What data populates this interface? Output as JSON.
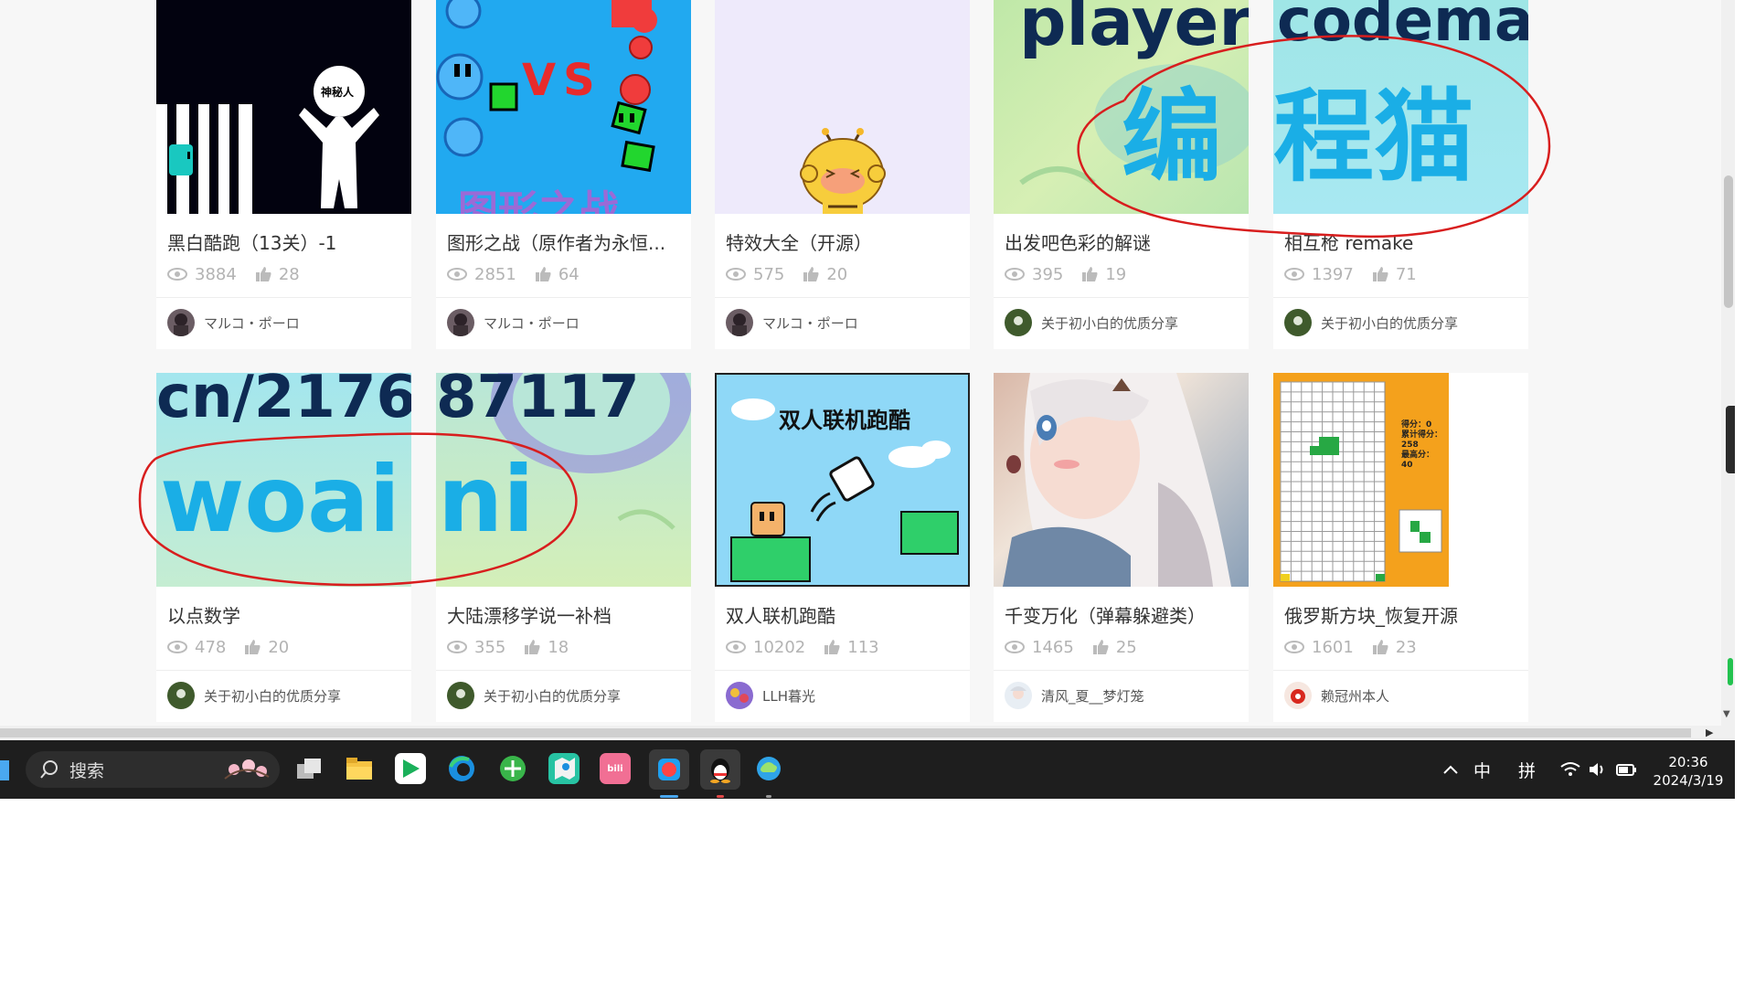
{
  "cards": [
    {
      "title": "黑白酷跑（13关）-1",
      "views": "3884",
      "likes": "28",
      "author": "マルコ・ポーロ"
    },
    {
      "title": "图形之战（原作者为永恒...",
      "views": "2851",
      "likes": "64",
      "author": "マルコ・ポーロ"
    },
    {
      "title": "特效大全（开源）",
      "views": "575",
      "likes": "20",
      "author": "マルコ・ポーロ"
    },
    {
      "title": "出发吧色彩的解谜",
      "views": "395",
      "likes": "19",
      "author": "关于初小白的优质分享"
    },
    {
      "title": "相互枪 remake",
      "views": "1397",
      "likes": "71",
      "author": "关于初小白的优质分享"
    },
    {
      "title": "以点数学",
      "views": "478",
      "likes": "20",
      "author": "关于初小白的优质分享"
    },
    {
      "title": "大陆漂移学说一补档",
      "views": "355",
      "likes": "18",
      "author": "关于初小白的优质分享"
    },
    {
      "title": "双人联机跑酷",
      "views": "10202",
      "likes": "113",
      "author": "LLH暮光"
    },
    {
      "title": "千变万化（弹幕躲避类）",
      "views": "1465",
      "likes": "25",
      "author": "清风_夏__梦灯笼"
    },
    {
      "title": "俄罗斯方块_恢复开源",
      "views": "1601",
      "likes": "23",
      "author": "赖冠州本人"
    }
  ],
  "thumb_text": {
    "mystery_label": "神秘人",
    "vs": "VS",
    "shape_war": "图形之战",
    "player": "player.",
    "codemao": "codemao.",
    "bian": "编",
    "cheng_mao": "程猫",
    "url_a": "cn/2176",
    "url_b": "87117",
    "woai": "woai",
    "ni": "ni",
    "parkour": "双人联机跑酷",
    "tetris_score": "得分：0",
    "tetris_total": "累计得分：",
    "tetris_total_val": "258",
    "tetris_best": "最高分：",
    "tetris_best_val": "40"
  },
  "taskbar": {
    "search_placeholder": "搜索",
    "ime_zh": "中",
    "ime_pin": "拼",
    "time": "20:36",
    "date": "2024/3/19"
  },
  "colors": {
    "annotation": "#d81e1e",
    "view_icon": "#bbbbbb"
  }
}
